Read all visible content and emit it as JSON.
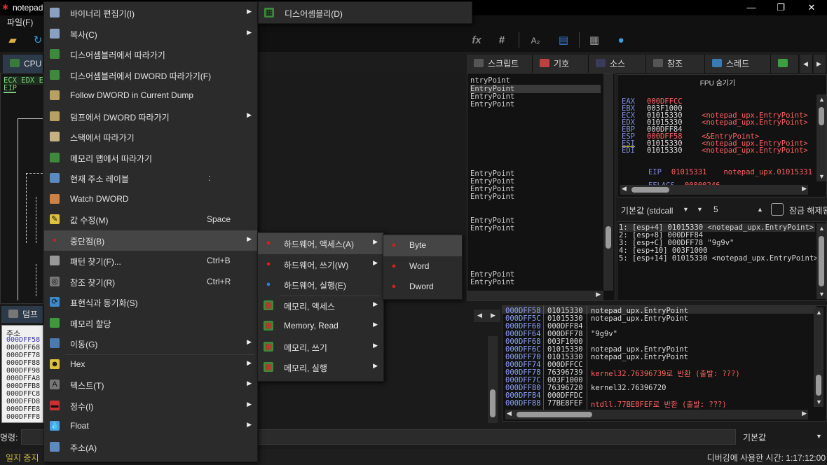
{
  "window": {
    "title": "notepad",
    "min": "—",
    "max": "❐",
    "close": "✕",
    "menu_file": "파일(F)"
  },
  "toolbar": {
    "icons": [
      "folder-icon",
      "refresh-icon",
      "function-icon",
      "hash-icon",
      "font-size-icon",
      "script-file-icon",
      "calculator-icon",
      "globe-icon"
    ],
    "fx_label": "fx",
    "hash_label": "#",
    "font_label": "A₂"
  },
  "tabs": [
    {
      "label": "CPU",
      "color": "#3a7a3a"
    },
    {
      "label": "스크립트",
      "color": "#6b6b6b"
    },
    {
      "label": "기호",
      "color": "#c04040"
    },
    {
      "label": "소스",
      "color": "#5a5a8a"
    },
    {
      "label": "참조",
      "color": "#707070"
    },
    {
      "label": "스레드",
      "color": "#3a7ab0"
    }
  ],
  "cpu_left": {
    "regs_line1": "ECX EDX E",
    "regs_line2": "EIP"
  },
  "disasm_right": {
    "lines": [
      "ntryPoint",
      "EntryPoint",
      "EntryPoint",
      "EntryPoint",
      "EntryPoint",
      "EntryPoint",
      "EntryPoint",
      "EntryPoint",
      "EntryPoint",
      "EntryPoint",
      "EntryPoint",
      "EntryPoint"
    ]
  },
  "fpu": {
    "header": "FPU 숨기기",
    "registers": [
      {
        "name": "EAX",
        "value": "000DFFCC",
        "comment": "",
        "value_red": true
      },
      {
        "name": "EBX",
        "value": "003F1000",
        "comment": "",
        "value_red": false
      },
      {
        "name": "ECX",
        "value": "01015330",
        "comment": "<notepad_upx.EntryPoint>",
        "value_red": false
      },
      {
        "name": "EDX",
        "value": "01015330",
        "comment": "<notepad_upx.EntryPoint>",
        "value_red": false
      },
      {
        "name": "EBP",
        "value": "000DFF84",
        "comment": "",
        "value_red": false
      },
      {
        "name": "ESP",
        "value": "000DFF58",
        "comment": "<&EntryPoint>",
        "value_red": true
      },
      {
        "name": "ESI",
        "value": "01015330",
        "comment": "<notepad_upx.EntryPoint>",
        "value_red": false
      },
      {
        "name": "EDI",
        "value": "01015330",
        "comment": "<notepad_upx.EntryPoint>",
        "value_red": false
      }
    ],
    "eip_name": "EIP",
    "eip_value": "01015331",
    "eip_comment": "notepad_upx.01015331",
    "eflags_name": "EFLAGS",
    "eflags_value": "00000246"
  },
  "callconv": {
    "select_value": "기본값 (stdcall",
    "count_value": "5",
    "checkbox_label": "잠금 해제됨",
    "args": [
      "1: [esp+4] 01015330 <notepad_upx.EntryPoint>",
      "2: [esp+8] 000DFF84",
      "3: [esp+C] 000DFF78 \"9g9v\"",
      "4: [esp+10] 003F1000",
      "5: [esp+14] 01015330 <notepad_upx.EntryPoint>"
    ]
  },
  "dump_left": {
    "tab_label": "덤프",
    "header": "주소",
    "rows": [
      "000DFF58",
      "000DFF68",
      "000DFF78",
      "000DFF88",
      "000DFF98",
      "000DFFA8",
      "000DFFB8",
      "000DFFC8",
      "000DFFD8",
      "000DFFE8",
      "000DFFF8"
    ]
  },
  "stack": {
    "rows": [
      {
        "addr": "000DFF58",
        "val": "01015330",
        "comment": "notepad_upx.EntryPoint",
        "red": false
      },
      {
        "addr": "000DFF5C",
        "val": "01015330",
        "comment": "notepad_upx.EntryPoint",
        "red": false
      },
      {
        "addr": "000DFF60",
        "val": "000DFF84",
        "comment": "",
        "red": false
      },
      {
        "addr": "000DFF64",
        "val": "000DFF78",
        "comment": "\"9g9v\"",
        "red": false
      },
      {
        "addr": "000DFF68",
        "val": "003F1000",
        "comment": "",
        "red": false
      },
      {
        "addr": "000DFF6C",
        "val": "01015330",
        "comment": "notepad_upx.EntryPoint",
        "red": false
      },
      {
        "addr": "000DFF70",
        "val": "01015330",
        "comment": "notepad_upx.EntryPoint",
        "red": false
      },
      {
        "addr": "000DFF74",
        "val": "000DFFCC",
        "comment": "",
        "red": false
      },
      {
        "addr": "000DFF78",
        "val": "76396739",
        "comment": "kernel32.76396739로 반환 (출발: ???)",
        "red": true
      },
      {
        "addr": "000DFF7C",
        "val": "003F1000",
        "comment": "",
        "red": false
      },
      {
        "addr": "000DFF80",
        "val": "76396720",
        "comment": "kernel32.76396720",
        "red": false
      },
      {
        "addr": "000DFF84",
        "val": "000DFFDC",
        "comment": "",
        "red": false
      },
      {
        "addr": "000DFF88",
        "val": "77BE8FEF",
        "comment": "ntdll.77BE8FEF로 반환 (출발: ???)",
        "red": true
      }
    ]
  },
  "command": {
    "label": "명령:",
    "default_label": "기본값"
  },
  "status": {
    "left": "일지 중지",
    "right": "디버깅에 사용한 시간: 1:17:12:00"
  },
  "menu_main": {
    "items": [
      {
        "label": "바이너리 편집기(I)",
        "shortcut": "",
        "submenu": true,
        "icon": "binary-editor-icon"
      },
      {
        "label": "복사(C)",
        "shortcut": "",
        "submenu": true,
        "icon": "copy-icon"
      },
      {
        "label": "디스어셈블러에서 따라가기",
        "shortcut": "",
        "submenu": false,
        "icon": "follow-disasm-icon"
      },
      {
        "label": "디스어셈블러에서 DWORD 따라가기(F)",
        "shortcut": "",
        "submenu": false,
        "icon": "follow-dword-disasm-icon"
      },
      {
        "label": "Follow DWORD in Current Dump",
        "shortcut": "",
        "submenu": false,
        "icon": "follow-dword-dump-icon"
      },
      {
        "label": "덤프에서 DWORD 따라가기",
        "shortcut": "",
        "submenu": true,
        "icon": "dump-dword-icon"
      },
      {
        "label": "스택에서 따라가기",
        "shortcut": "",
        "submenu": false,
        "icon": "stack-icon"
      },
      {
        "label": "메모리 맵에서 따라가기",
        "shortcut": "",
        "submenu": false,
        "icon": "memory-map-icon"
      },
      {
        "label": "현재 주소 레이블",
        "shortcut": ":",
        "submenu": false,
        "icon": "label-icon"
      },
      {
        "label": "Watch DWORD",
        "shortcut": "",
        "submenu": false,
        "icon": "watch-icon"
      },
      {
        "label": "값 수정(M)",
        "shortcut": "Space",
        "submenu": false,
        "icon": "edit-pencil-icon"
      },
      {
        "label": "중단점(B)",
        "shortcut": "",
        "submenu": true,
        "icon": "breakpoint-icon",
        "highlight": true
      },
      {
        "label": "패턴 찾기(F)...",
        "shortcut": "Ctrl+B",
        "submenu": false,
        "icon": "find-pattern-icon"
      },
      {
        "label": "참조 찾기(R)",
        "shortcut": "Ctrl+R",
        "submenu": false,
        "icon": "binoculars-icon"
      },
      {
        "label": "표현식과 동기화(S)",
        "shortcut": "",
        "submenu": false,
        "icon": "sync-icon"
      },
      {
        "label": "메모리 할당",
        "shortcut": "",
        "submenu": false,
        "icon": "allocate-icon"
      },
      {
        "label": "이동(G)",
        "shortcut": "",
        "submenu": true,
        "icon": "goto-icon"
      },
      {
        "label": "Hex",
        "shortcut": "",
        "submenu": true,
        "icon": "hex-icon"
      },
      {
        "label": "텍스트(T)",
        "shortcut": "",
        "submenu": true,
        "icon": "text-icon"
      },
      {
        "label": "정수(I)",
        "shortcut": "",
        "submenu": true,
        "icon": "integer-icon"
      },
      {
        "label": "Float",
        "shortcut": "",
        "submenu": true,
        "icon": "float-icon"
      },
      {
        "label": "주소(A)",
        "shortcut": "",
        "submenu": false,
        "icon": "address-icon"
      }
    ]
  },
  "menu_binary": {
    "item": "디스어셈블리(D)"
  },
  "menu_bp": {
    "items": [
      {
        "label": "하드웨어, 액세스(A)",
        "submenu": true,
        "highlight": true
      },
      {
        "label": "하드웨어, 쓰기(W)",
        "submenu": true
      },
      {
        "label": "하드웨어, 실행(E)",
        "submenu": false
      },
      {
        "label": "메모리, 액세스",
        "submenu": true
      },
      {
        "label": "Memory, Read",
        "submenu": true
      },
      {
        "label": "메모리, 쓰기",
        "submenu": true
      },
      {
        "label": "메모리, 실행",
        "submenu": true
      }
    ]
  },
  "menu_size": {
    "items": [
      {
        "label": "Byte",
        "highlight": true
      },
      {
        "label": "Word"
      },
      {
        "label": "Dword"
      }
    ]
  }
}
